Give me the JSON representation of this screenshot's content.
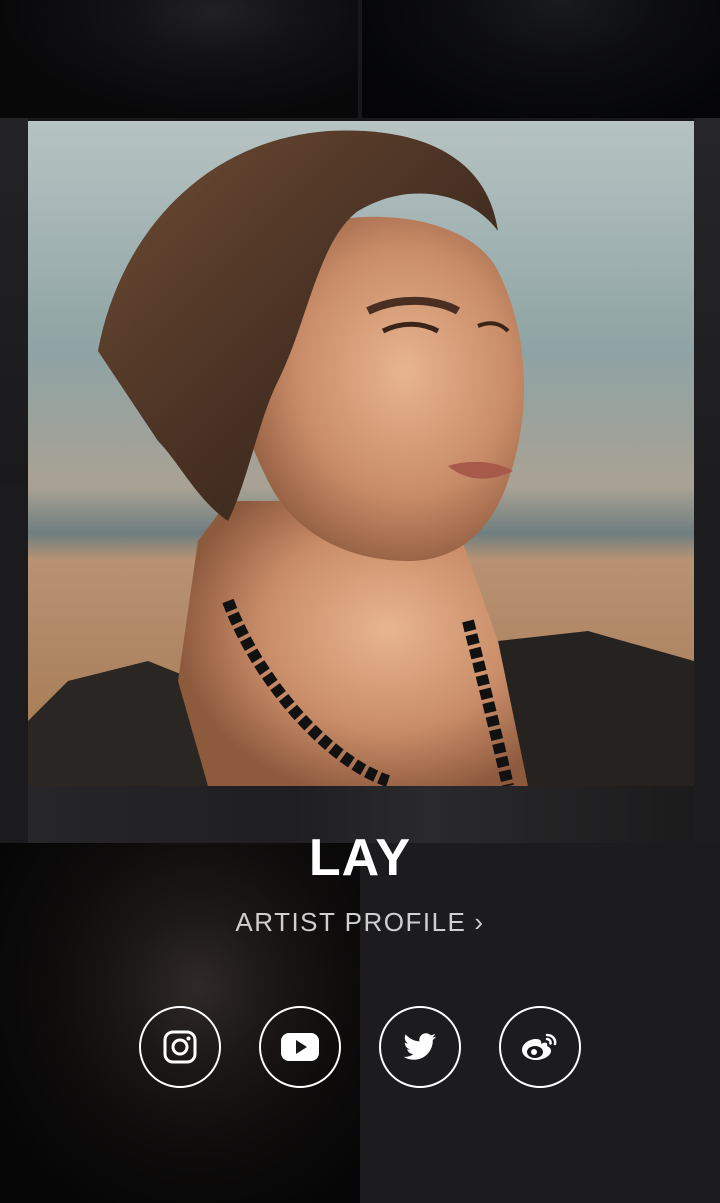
{
  "artist": {
    "name": "LAY",
    "profile_link_label": "ARTIST PROFILE",
    "profile_link_chevron": "›"
  },
  "socials": [
    {
      "network": "Instagram",
      "icon": "instagram-icon"
    },
    {
      "network": "YouTube",
      "icon": "youtube-icon"
    },
    {
      "network": "Twitter",
      "icon": "twitter-icon"
    },
    {
      "network": "Weibo",
      "icon": "weibo-icon"
    }
  ],
  "colors": {
    "background": "#18181a",
    "text_primary": "#ffffff",
    "text_secondary": "#cfcfcf",
    "icon_stroke": "#ffffff"
  }
}
